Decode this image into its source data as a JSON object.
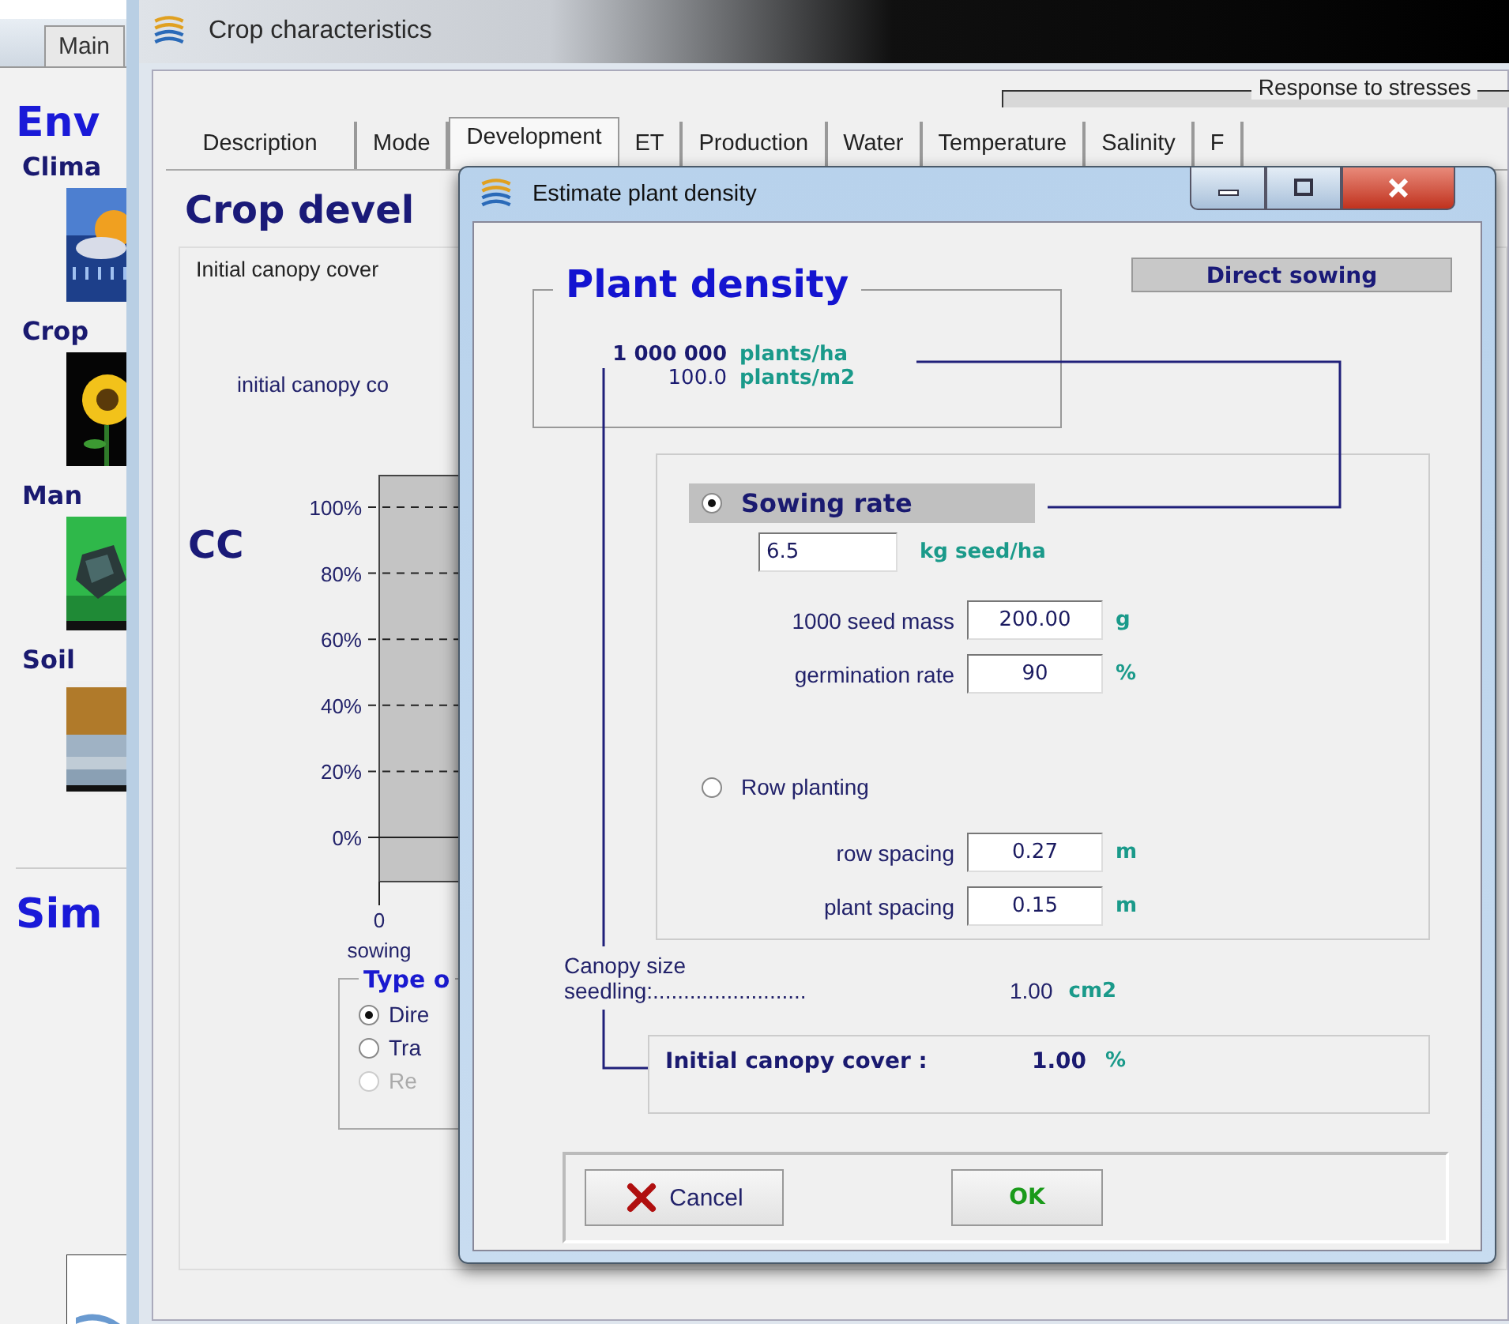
{
  "main_window": {
    "tab": "Main",
    "sections": [
      {
        "kind": "heading",
        "label": "Env"
      },
      {
        "kind": "item",
        "label": "Clima"
      },
      {
        "kind": "item",
        "label": "Crop"
      },
      {
        "kind": "item",
        "label": "Man"
      },
      {
        "kind": "item",
        "label": "Soil"
      },
      {
        "kind": "heading",
        "label": "Sim"
      },
      {
        "kind": "picture"
      }
    ]
  },
  "crop_window": {
    "title": "Crop characteristics",
    "tab_group": "Response to stresses",
    "tabs": [
      {
        "label": "Description",
        "selected": false
      },
      {
        "label": "Mode",
        "selected": false
      },
      {
        "label": "Development",
        "selected": true
      },
      {
        "label": "ET",
        "selected": false
      },
      {
        "label": "Production",
        "selected": false
      },
      {
        "label": "Water",
        "selected": false
      },
      {
        "label": "Temperature",
        "selected": false
      },
      {
        "label": "Salinity",
        "selected": false
      },
      {
        "label": "F",
        "selected": false
      }
    ],
    "page": {
      "heading": "Crop devel",
      "panel_label": "Initial canopy cover",
      "field_label": "initial canopy co",
      "cc_axis": {
        "title": "CC",
        "ticks": [
          "100%",
          "80%",
          "60%",
          "40%",
          "20%",
          "0%"
        ],
        "x_tick": "0",
        "x_caption": "sowing"
      },
      "type_group": {
        "title": "Type o",
        "options": [
          {
            "label": "Dire",
            "selected": true,
            "disabled": false
          },
          {
            "label": "Tra",
            "selected": false,
            "disabled": false
          },
          {
            "label": "Re",
            "selected": false,
            "disabled": true
          }
        ]
      }
    }
  },
  "dialog": {
    "title": "Estimate plant density",
    "badge": "Direct sowing",
    "density": {
      "title": "Plant density",
      "rows": [
        {
          "value": "1 000 000",
          "unit": "plants/ha",
          "emphasis": true
        },
        {
          "value": "100.0",
          "unit": "plants/m2",
          "emphasis": false
        }
      ]
    },
    "methods": [
      {
        "label": "Sowing rate",
        "selected": true,
        "input": {
          "value": "6.5",
          "unit": "kg seed/ha"
        },
        "fields": [
          {
            "label": "1000 seed mass",
            "value": "200.00",
            "unit": "g"
          },
          {
            "label": "germination rate",
            "value": "90",
            "unit": "%"
          }
        ]
      },
      {
        "label": "Row planting",
        "selected": false,
        "fields": [
          {
            "label": "row spacing",
            "value": "0.27",
            "unit": "m"
          },
          {
            "label": "plant spacing",
            "value": "0.15",
            "unit": "m"
          }
        ]
      }
    ],
    "canopy": {
      "line1": "Canopy size",
      "line2": "seedling:.........................",
      "value": "1.00",
      "unit": "cm2"
    },
    "initial_cover": {
      "label": "Initial canopy cover :",
      "value": "1.00",
      "unit": "%"
    },
    "buttons": [
      {
        "label": "Cancel",
        "kind": "cancel"
      },
      {
        "label": "OK",
        "kind": "ok"
      }
    ]
  }
}
